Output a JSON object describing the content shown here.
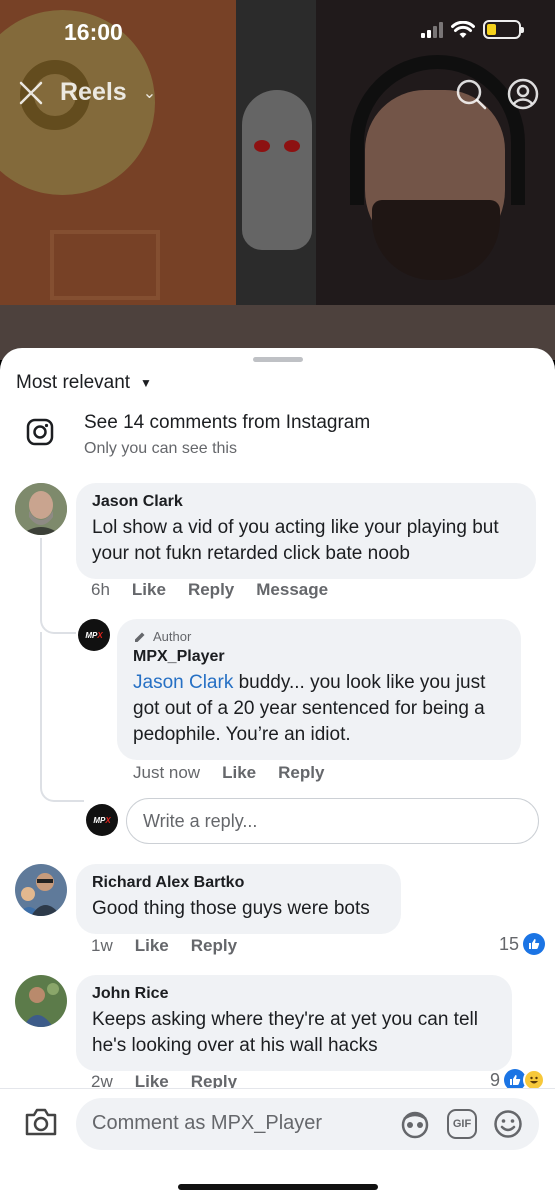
{
  "status_bar": {
    "time": "16:00"
  },
  "header": {
    "title": "Reels"
  },
  "sheet": {
    "sort_label": "Most relevant",
    "instagram": {
      "title": "See 14 comments from Instagram",
      "subtitle": "Only you can see this"
    },
    "comments": [
      {
        "author": "Jason Clark",
        "text": "Lol show a vid of you acting like your playing but your not fukn retarded click bate noob",
        "time": "6h",
        "like": "Like",
        "reply": "Reply",
        "message": "Message"
      },
      {
        "author_tag": "Author",
        "author": "MPX_Player",
        "mention": "Jason Clark",
        "text": " buddy... you look like you just got out of a 20 year sentenced for being a pedophile. You’re an idiot.",
        "time": "Just now",
        "like": "Like",
        "reply": "Reply"
      },
      {
        "author": "Richard Alex Bartko",
        "text": "Good thing those guys were bots",
        "time": "1w",
        "like": "Like",
        "reply": "Reply",
        "reactions": "15"
      },
      {
        "author": "John Rice",
        "text": "Keeps asking where they're at yet you can tell he's looking over at his wall hacks",
        "time": "2w",
        "like": "Like",
        "reply": "Reply",
        "reactions": "9"
      }
    ],
    "reply_placeholder": "Write a reply..."
  },
  "composer": {
    "placeholder": "Comment as MPX_Player",
    "gif_label": "GIF"
  },
  "avatar_logo": {
    "prefix": "MP",
    "accent": "X"
  },
  "colors": {
    "link": "#2670c4",
    "like_blue": "#1b74e4",
    "bubble": "#f0f2f5"
  }
}
